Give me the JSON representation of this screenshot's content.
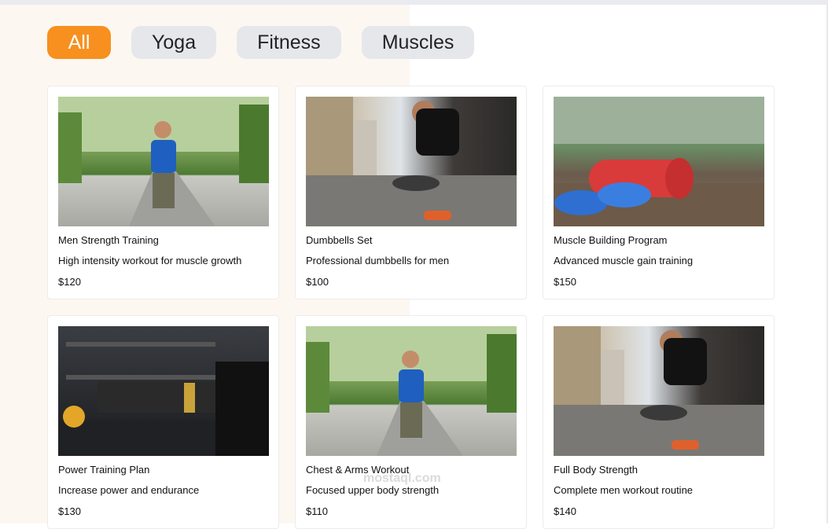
{
  "filters": [
    {
      "label": "All",
      "active": true
    },
    {
      "label": "Yoga",
      "active": false
    },
    {
      "label": "Fitness",
      "active": false
    },
    {
      "label": "Muscles",
      "active": false
    }
  ],
  "products": [
    {
      "title": "Men Strength Training",
      "desc": "High intensity workout for muscle growth",
      "price": "$120",
      "image": "runner-in-park"
    },
    {
      "title": "Dumbbells Set",
      "desc": "Professional dumbbells for men",
      "price": "$100",
      "image": "man-tying-shoes-street"
    },
    {
      "title": "Muscle Building Program",
      "desc": "Advanced muscle gain training",
      "price": "$150",
      "image": "yoga-mat-and-sneakers"
    },
    {
      "title": "Power Training Plan",
      "desc": "Increase power and endurance",
      "price": "$130",
      "image": "gym-weights-rack"
    },
    {
      "title": "Chest & Arms Workout",
      "desc": "Focused upper body strength",
      "price": "$110",
      "image": "runner-in-park"
    },
    {
      "title": "Full Body Strength",
      "desc": "Complete men workout routine",
      "price": "$140",
      "image": "man-tying-shoes-street"
    }
  ],
  "watermark": "mostaql.com",
  "colors": {
    "accent": "#f7901e",
    "filter_bg": "#e5e7eb",
    "page_left_bg": "#fdf7f2"
  }
}
